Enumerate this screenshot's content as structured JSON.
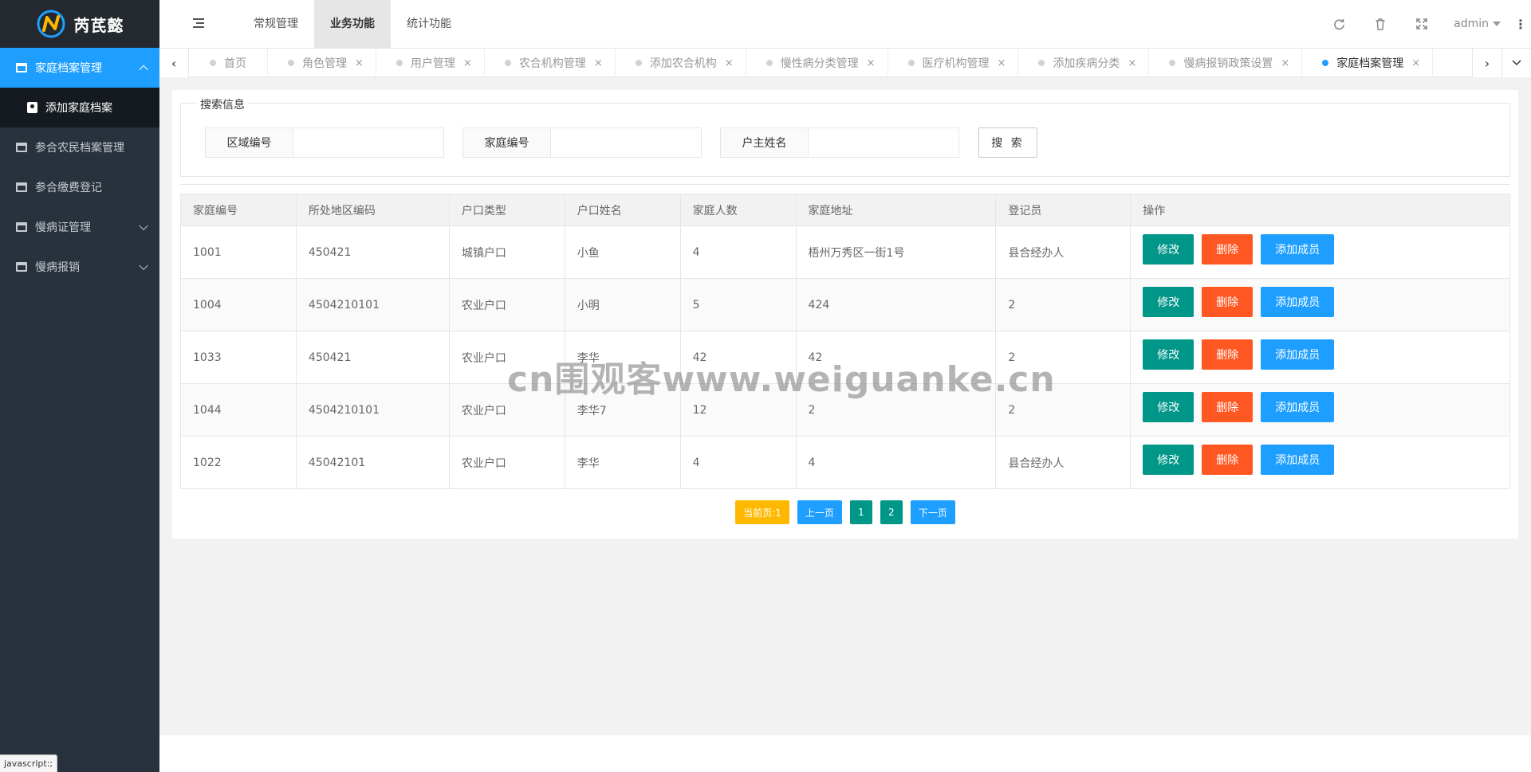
{
  "app": {
    "logo_text": "芮芪懿"
  },
  "sidebar": {
    "items": [
      {
        "label": "家庭档案管理",
        "active": true,
        "expanded": true
      },
      {
        "label": "添加家庭档案",
        "sub": true
      },
      {
        "label": "参合农民档案管理"
      },
      {
        "label": "参合缴费登记"
      },
      {
        "label": "慢病证管理",
        "has_children": true
      },
      {
        "label": "慢病报销",
        "has_children": true
      }
    ]
  },
  "header": {
    "menus": [
      {
        "label": "常规管理"
      },
      {
        "label": "业务功能",
        "active": true
      },
      {
        "label": "统计功能"
      }
    ],
    "user": "admin",
    "icons": [
      "refresh-icon",
      "trash-icon",
      "fullscreen-icon",
      "more-icon"
    ]
  },
  "tabs": [
    {
      "label": "首页",
      "closable": false
    },
    {
      "label": "角色管理",
      "closable": true
    },
    {
      "label": "用户管理",
      "closable": true
    },
    {
      "label": "农合机构管理",
      "closable": true
    },
    {
      "label": "添加农合机构",
      "closable": true
    },
    {
      "label": "慢性病分类管理",
      "closable": true
    },
    {
      "label": "医疗机构管理",
      "closable": true
    },
    {
      "label": "添加疾病分类",
      "closable": true
    },
    {
      "label": "慢病报销政策设置",
      "closable": true
    },
    {
      "label": "家庭档案管理",
      "closable": true,
      "active": true
    }
  ],
  "tab_close_glyph": "×",
  "search": {
    "legend": "搜索信息",
    "fields": [
      {
        "label": "区域编号",
        "value": ""
      },
      {
        "label": "家庭编号",
        "value": ""
      },
      {
        "label": "户主姓名",
        "value": ""
      }
    ],
    "button": "搜 索"
  },
  "table": {
    "columns": [
      "家庭编号",
      "所处地区编码",
      "户口类型",
      "户口姓名",
      "家庭人数",
      "家庭地址",
      "登记员",
      "操作"
    ],
    "rows": [
      [
        "1001",
        "450421",
        "城镇户口",
        "小鱼",
        "4",
        "梧州万秀区一街1号",
        "县合经办人"
      ],
      [
        "1004",
        "4504210101",
        "农业户口",
        "小明",
        "5",
        "424",
        "2"
      ],
      [
        "1033",
        "450421",
        "农业户口",
        "李华",
        "42",
        "42",
        "2"
      ],
      [
        "1044",
        "4504210101",
        "农业户口",
        "李华7",
        "12",
        "2",
        "2"
      ],
      [
        "1022",
        "45042101",
        "农业户口",
        "李华",
        "4",
        "4",
        "县合经办人"
      ]
    ],
    "actions": {
      "edit": "修改",
      "delete": "删除",
      "add_member": "添加成员"
    }
  },
  "pagination": {
    "current": "当前页:1",
    "prev": "上一页",
    "pages": [
      "1",
      "2"
    ],
    "next": "下一页"
  },
  "status_bar": "javascript:;",
  "watermark": "cn围观客www.weiguanke.cn",
  "colors": {
    "primary": "#1e9fff",
    "success": "#009688",
    "danger": "#ff5722",
    "warning": "#ffb800",
    "sidebar": "#28323c"
  }
}
